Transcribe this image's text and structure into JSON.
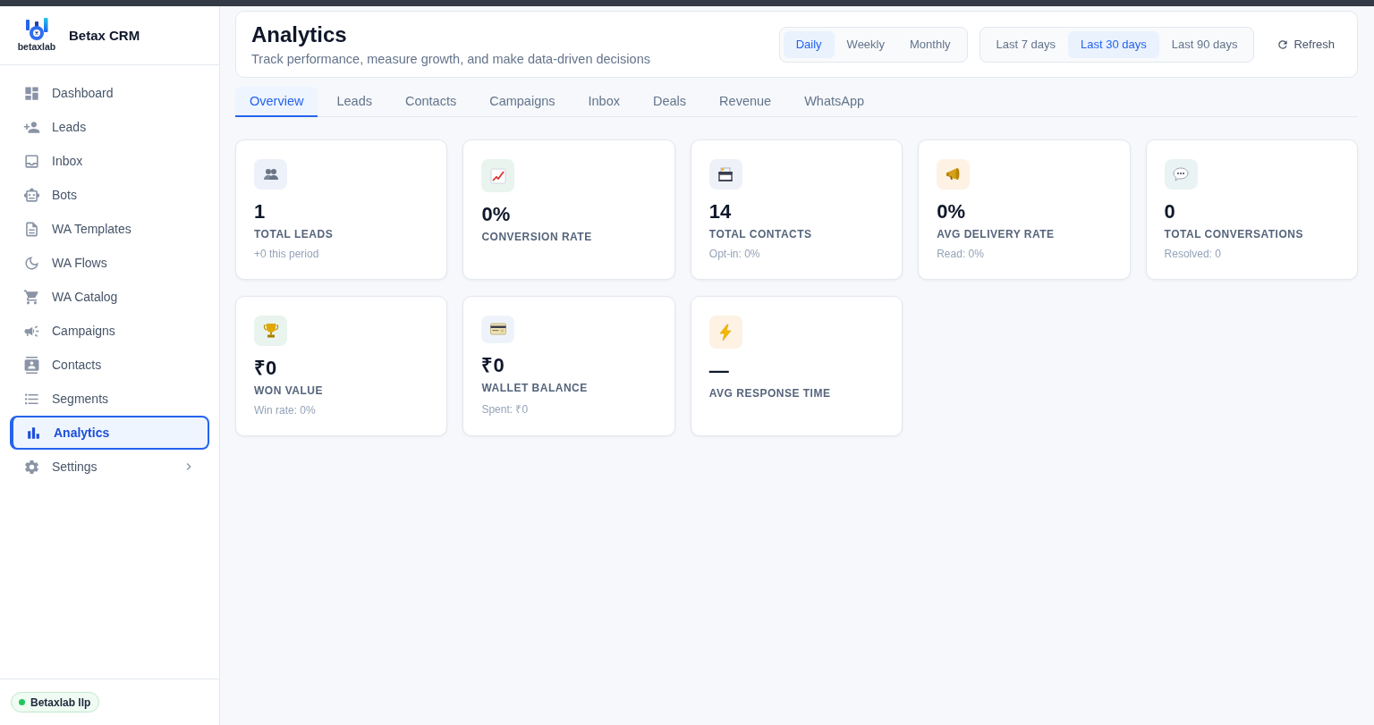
{
  "sidebar": {
    "brand": {
      "logo_text": "betaxlab",
      "name": "Betax CRM"
    },
    "items": [
      {
        "label": "Dashboard",
        "kind": "link",
        "selected": false
      },
      {
        "label": "Leads",
        "kind": "link",
        "selected": false
      },
      {
        "label": "Inbox",
        "kind": "link",
        "selected": false
      },
      {
        "label": "Bots",
        "kind": "link",
        "selected": false
      },
      {
        "label": "WA Templates",
        "kind": "link",
        "selected": false
      },
      {
        "label": "WA Flows",
        "kind": "link",
        "selected": false
      },
      {
        "label": "WA Catalog",
        "kind": "link",
        "selected": false
      },
      {
        "label": "Campaigns",
        "kind": "link",
        "selected": false
      },
      {
        "label": "Contacts",
        "kind": "link",
        "selected": false
      },
      {
        "label": "Segments",
        "kind": "link",
        "selected": false
      },
      {
        "label": "Analytics",
        "kind": "link",
        "selected": true
      },
      {
        "label": "Settings",
        "kind": "group",
        "selected": false,
        "expanded": false
      }
    ],
    "workspace": {
      "name": "Betaxlab llp",
      "online": true
    }
  },
  "header": {
    "title": "Analytics",
    "subtitle": "Track performance, measure growth, and make data-driven decisions",
    "granularity": [
      {
        "label": "Daily",
        "selected": true
      },
      {
        "label": "Weekly",
        "selected": false
      },
      {
        "label": "Monthly",
        "selected": false
      }
    ],
    "ranges": [
      {
        "label": "Last 7 days",
        "selected": false
      },
      {
        "label": "Last 30 days",
        "selected": true
      },
      {
        "label": "Last 90 days",
        "selected": false
      }
    ],
    "refresh": {
      "label": "Refresh"
    }
  },
  "tabs": [
    {
      "label": "Overview",
      "selected": true
    },
    {
      "label": "Leads",
      "selected": false
    },
    {
      "label": "Contacts",
      "selected": false
    },
    {
      "label": "Campaigns",
      "selected": false
    },
    {
      "label": "Inbox",
      "selected": false
    },
    {
      "label": "Deals",
      "selected": false
    },
    {
      "label": "Revenue",
      "selected": false
    },
    {
      "label": "WhatsApp",
      "selected": false
    }
  ],
  "cards": [
    {
      "kind": "people",
      "value": "1",
      "label": "TOTAL LEADS",
      "note": "+0 this period"
    },
    {
      "kind": "trend",
      "value": "0%",
      "label": "CONVERSION RATE"
    },
    {
      "kind": "filebox",
      "value": "14",
      "label": "TOTAL CONTACTS",
      "note": "Opt-in: 0%"
    },
    {
      "kind": "megaphone",
      "value": "0%",
      "label": "AVG DELIVERY RATE",
      "note": "Read: 0%"
    },
    {
      "kind": "bubble",
      "value": "0",
      "label": "TOTAL CONVERSATIONS",
      "note": "Resolved: 0"
    },
    {
      "kind": "trophy",
      "value": "₹0",
      "label": "WON VALUE",
      "note": "Win rate: 0%"
    },
    {
      "kind": "card",
      "value": "₹0",
      "label": "WALLET BALANCE",
      "note": "Spent: ₹0"
    },
    {
      "kind": "bolt",
      "value": "—",
      "label": "AVG RESPONSE TIME"
    }
  ]
}
